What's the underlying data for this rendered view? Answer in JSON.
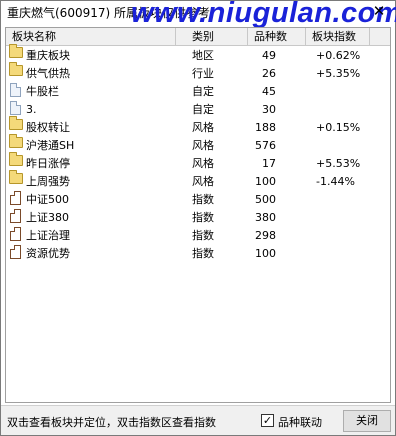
{
  "window": {
    "title": "重庆燃气(600917)  所属板块仅供参考",
    "watermark": "www.niugulan.com",
    "close_glyph": "✕"
  },
  "table": {
    "headers": {
      "name": "板块名称",
      "type": "类别",
      "count": "品种数",
      "index": "板块指数"
    },
    "rows": [
      {
        "icon": "folder-icon",
        "name": "重庆板块",
        "type": "地区",
        "count": "49",
        "index": "+0.62%"
      },
      {
        "icon": "folder-icon",
        "name": "供气供热",
        "type": "行业",
        "count": "26",
        "index": "+5.35%"
      },
      {
        "icon": "doc-icon",
        "name": "牛股栏",
        "type": "自定",
        "count": "45",
        "index": ""
      },
      {
        "icon": "doc-icon",
        "name": "3.",
        "type": "自定",
        "count": "30",
        "index": ""
      },
      {
        "icon": "folder-icon",
        "name": "股权转让",
        "type": "风格",
        "count": "188",
        "index": "+0.15%"
      },
      {
        "icon": "folder-icon",
        "name": "沪港通SH",
        "type": "风格",
        "count": "576",
        "index": ""
      },
      {
        "icon": "folder-icon",
        "name": "昨日涨停",
        "type": "风格",
        "count": "17",
        "index": "+5.53%"
      },
      {
        "icon": "folder-icon",
        "name": "上周强势",
        "type": "风格",
        "count": "100",
        "index": "-1.44%"
      },
      {
        "icon": "index-icon",
        "name": "中证500",
        "type": "指数",
        "count": "500",
        "index": ""
      },
      {
        "icon": "index-icon",
        "name": "上证380",
        "type": "指数",
        "count": "380",
        "index": ""
      },
      {
        "icon": "index-icon",
        "name": "上证治理",
        "type": "指数",
        "count": "298",
        "index": ""
      },
      {
        "icon": "index-icon",
        "name": "资源优势",
        "type": "指数",
        "count": "100",
        "index": ""
      }
    ]
  },
  "status": {
    "hint": "双击查看板块并定位，双击指数区查看指数",
    "checkbox_label": "品种联动",
    "checkbox_checked": true,
    "checkbox_glyph": "✓",
    "close_button": "关闭"
  }
}
